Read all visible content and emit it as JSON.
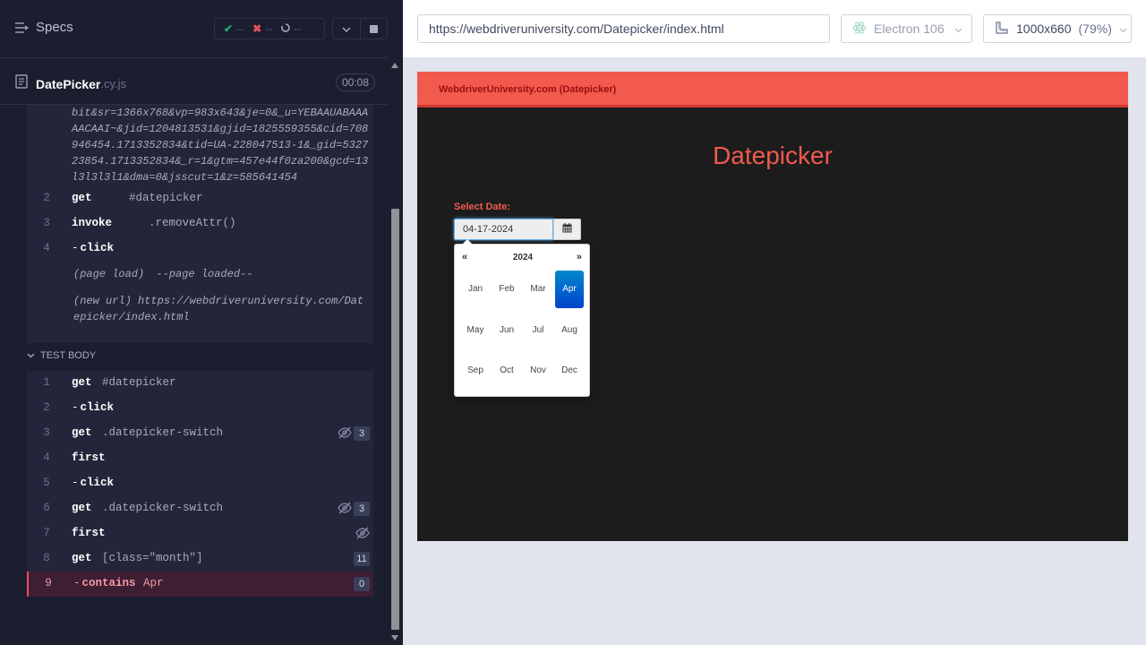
{
  "reporter": {
    "specs_label": "Specs",
    "stats": {
      "passed": "--",
      "failed": "--",
      "pending": "--"
    },
    "spec_name": "DatePicker",
    "spec_ext": ".cy.js",
    "duration": "00:08",
    "url_fragment": "bit&sr=1366x768&vp=983x643&je=0&_u=YEBAAUABAAAAACAAI~&jid=1204813531&gjid=1825559355&cid=708946454.1713352834&tid=UA-228047513-1&_gid=532723854.1713352834&_r=1&gtm=457e44f0za200&gcd=13l3l3l3l1&dma=0&jsscut=1&z=585641454",
    "before_commands": [
      {
        "num": "2",
        "name": "get",
        "msg": "#datepicker"
      },
      {
        "num": "3",
        "name": "invoke",
        "msg": ".removeAttr()"
      },
      {
        "num": "4",
        "name": "click",
        "msg": ""
      }
    ],
    "page_load": {
      "label": "(page load)",
      "msg": "--page loaded--"
    },
    "new_url": {
      "label": "(new url)",
      "msg": "https://webdriveruniversity.com/Datepicker/index.html"
    },
    "test_body_label": "TEST BODY",
    "test_commands": [
      {
        "num": "1",
        "name": "get",
        "msg": "#datepicker",
        "badge": ""
      },
      {
        "num": "2",
        "name": "click",
        "msg": "",
        "badge": ""
      },
      {
        "num": "3",
        "name": "get",
        "msg": ".datepicker-switch",
        "badge": "3"
      },
      {
        "num": "4",
        "name": "first",
        "msg": "",
        "badge": ""
      },
      {
        "num": "5",
        "name": "click",
        "msg": "",
        "badge": ""
      },
      {
        "num": "6",
        "name": "get",
        "msg": ".datepicker-switch",
        "badge": "3"
      },
      {
        "num": "7",
        "name": "first",
        "msg": "",
        "badge": ""
      },
      {
        "num": "8",
        "name": "get",
        "msg": "[class=\"month\"]",
        "badge": "11"
      },
      {
        "num": "9",
        "name": "contains",
        "msg": "Apr",
        "badge": "0"
      }
    ]
  },
  "aut": {
    "url": "https://webdriveruniversity.com/Datepicker/index.html",
    "browser": "Electron 106",
    "viewport": "1000x660",
    "scale": "(79%)",
    "site": {
      "brand": "WebdriverUniversity.com (Datepicker)",
      "heading": "Datepicker",
      "select_label": "Select Date:",
      "date_value": "04-17-2024",
      "picker": {
        "prev": "«",
        "next": "»",
        "year": "2024",
        "months": [
          "Jan",
          "Feb",
          "Mar",
          "Apr",
          "May",
          "Jun",
          "Jul",
          "Aug",
          "Sep",
          "Oct",
          "Nov",
          "Dec"
        ],
        "active_month": "Apr"
      }
    }
  },
  "colors": {
    "accent": "#f25a4e",
    "pass": "#1fa971",
    "fail": "#e94f5f",
    "active_month": "#0066cc"
  },
  "icons": [
    "specs-list-icon",
    "check-icon",
    "x-icon",
    "spinner-icon",
    "chevron-down-icon",
    "stop-icon",
    "document-icon",
    "eye-slash-icon",
    "electron-icon",
    "ruler-icon",
    "calendar-icon"
  ]
}
